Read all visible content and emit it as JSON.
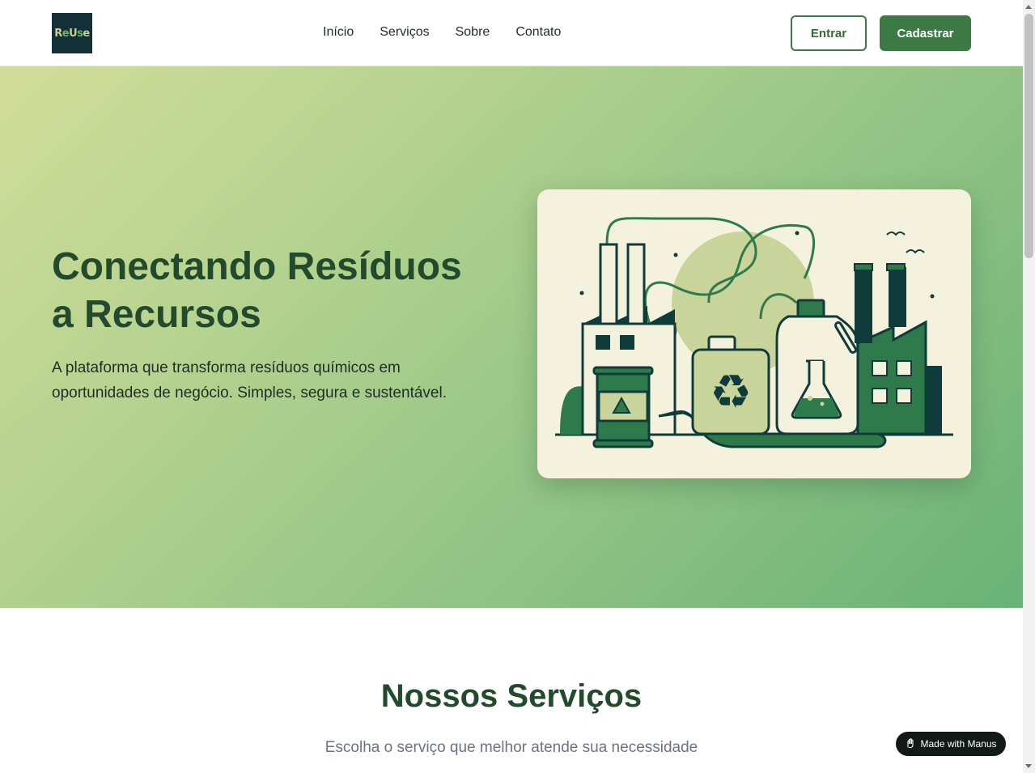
{
  "header": {
    "logo_text": "ReUse",
    "nav": [
      "Início",
      "Serviços",
      "Sobre",
      "Contato"
    ],
    "login_label": "Entrar",
    "signup_label": "Cadastrar"
  },
  "hero": {
    "title": "Conectando Resíduos a Recursos",
    "subtitle": "A plataforma que transforma resíduos químicos em oportunidades de negócio. Simples, segura e sustentável.",
    "illustration_icon": "factory-recycling-illustration"
  },
  "services": {
    "title": "Nossos Serviços",
    "subtitle": "Escolha o serviço que melhor atende sua necessidade"
  },
  "badge": {
    "label": "Made with Manus",
    "icon": "manus-hand-icon"
  },
  "colors": {
    "brand_dark": "#234a2c",
    "brand": "#3b7a45",
    "card_bg": "#f4f2dd",
    "logo_bg": "#13303a"
  }
}
